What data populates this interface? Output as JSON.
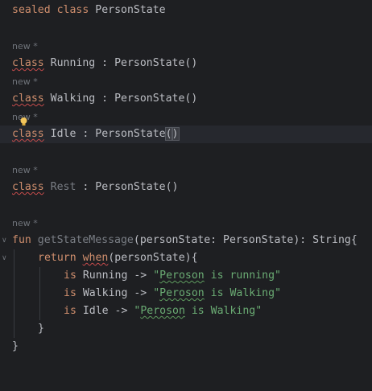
{
  "editor": {
    "line1": {
      "kw1": "sealed",
      "kw2": "class",
      "name": "PersonState"
    },
    "hints": {
      "h1": "new *",
      "h2": "new *",
      "h3": "new *",
      "h4": "new *",
      "h5": "new *"
    },
    "running": {
      "kw": "class",
      "name": "Running",
      "sep": " : ",
      "parent": "PersonState()"
    },
    "walking": {
      "kw": "class",
      "name": "Walking",
      "sep": " : ",
      "parent": "PersonState()"
    },
    "idle": {
      "kw": "class",
      "name": "Idle",
      "sep": " : ",
      "parent": "PersonState",
      "paren_open": "(",
      "paren_close": ")"
    },
    "rest": {
      "kw": "class",
      "name": "Rest",
      "sep": " : ",
      "parent": "PersonState()"
    },
    "fun": {
      "kw": "fun",
      "name": "getStateMessage",
      "params": "(personState: PersonState): String{"
    },
    "ret": {
      "kw": "return",
      "when": "when",
      "rest": "(personState){"
    },
    "b1": {
      "kw": "is",
      "type": "Running",
      "arrow": " -> ",
      "q1": "\"",
      "word": "Peroson",
      "tail": " is running\""
    },
    "b2": {
      "kw": "is",
      "type": "Walking",
      "arrow": " -> ",
      "q1": "\"",
      "word": "Peroson",
      "tail": " is ",
      "word2": "Walking",
      "end": "\""
    },
    "b3": {
      "kw": "is",
      "type": "Idle",
      "arrow": " -> ",
      "q1": "\"",
      "word": "Peroson",
      "tail": " is ",
      "word2": "Walking",
      "end": "\""
    },
    "close_inner": "}",
    "close_outer": "}",
    "fold_icons": [
      "chevron-down-icon",
      "chevron-down-icon"
    ]
  },
  "colors": {
    "background": "#1e1f22",
    "keyword": "#cf8e6d",
    "function": "#56a8f5",
    "string": "#6aab73",
    "text": "#bcbec4",
    "hint": "#6f737a"
  }
}
